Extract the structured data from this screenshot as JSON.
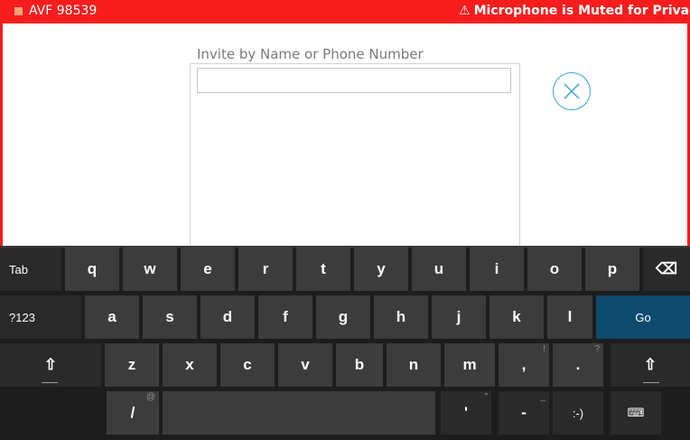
{
  "status_bar": {
    "title": "AVF 98539",
    "alert_icon": "⚠",
    "alert_text": "Microphone is Muted for Privacy",
    "color": "#f81c1c"
  },
  "invite": {
    "label": "Invite by Name or Phone Number",
    "input_value": "",
    "close_icon": "close-circle-icon",
    "accent": "#3aa3d6"
  },
  "keyboard": {
    "row1": [
      "Tab",
      "q",
      "w",
      "e",
      "r",
      "t",
      "y",
      "u",
      "i",
      "o",
      "p",
      "⌫"
    ],
    "row2": [
      "?123",
      "a",
      "s",
      "d",
      "f",
      "g",
      "h",
      "j",
      "k",
      "l",
      "Go"
    ],
    "row3": [
      "⇧",
      "z",
      "x",
      "c",
      "v",
      "b",
      "n",
      "m",
      ",",
      ".",
      "⇧"
    ],
    "row3_hints": {
      "comma": "!",
      "period": "?"
    },
    "row4": {
      "slash": "/",
      "slash_hint": "@",
      "space": "",
      "apostrophe": "'",
      "apostrophe_hint": "\"",
      "dash": "-",
      "dash_hint": "_",
      "smiley": ":-)",
      "keyboard_icon": "⌨"
    },
    "go_color": "#0e4a6d"
  }
}
